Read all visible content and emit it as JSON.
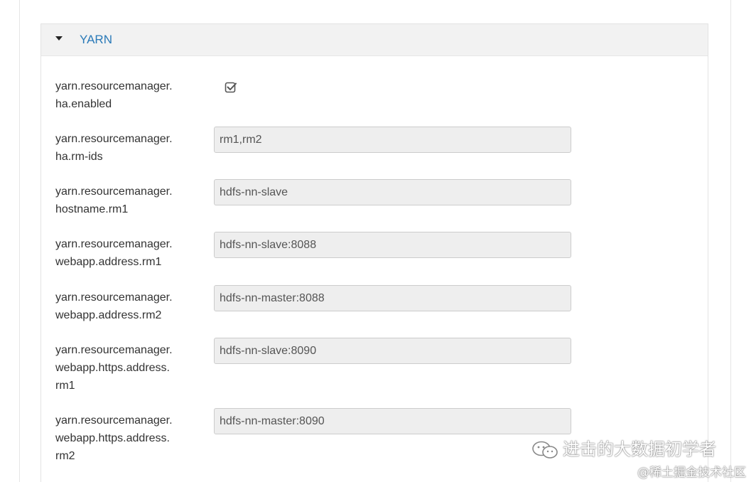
{
  "panel": {
    "title": "YARN"
  },
  "properties": [
    {
      "label_lines": [
        "yarn.resourcemanager.",
        "ha.enabled"
      ],
      "type": "checkbox",
      "checked": true
    },
    {
      "label_lines": [
        "yarn.resourcemanager.",
        "ha.rm-ids"
      ],
      "type": "text",
      "value": "rm1,rm2"
    },
    {
      "label_lines": [
        "yarn.resourcemanager.",
        "hostname.rm1"
      ],
      "type": "text",
      "value": "hdfs-nn-slave"
    },
    {
      "label_lines": [
        "yarn.resourcemanager.",
        "webapp.address.rm1"
      ],
      "type": "text",
      "value": "hdfs-nn-slave:8088"
    },
    {
      "label_lines": [
        "yarn.resourcemanager.",
        "webapp.address.rm2"
      ],
      "type": "text",
      "value": "hdfs-nn-master:8088"
    },
    {
      "label_lines": [
        "yarn.resourcemanager.",
        "webapp.https.address.",
        "rm1"
      ],
      "type": "text",
      "value": "hdfs-nn-slave:8090"
    },
    {
      "label_lines": [
        "yarn.resourcemanager.",
        "webapp.https.address.",
        "rm2"
      ],
      "type": "text",
      "value": "hdfs-nn-master:8090"
    }
  ],
  "watermark": {
    "line1": "进击的大数据初学者",
    "line2": "@稀土掘金技术社区"
  },
  "icons": {
    "caret": "caret-down-icon",
    "checkbox": "checkbox-checked-icon",
    "wechat": "wechat-icon"
  },
  "colors": {
    "title": "#2a7ab8",
    "header_bg": "#f2f2f2",
    "field_bg": "#eeeeee"
  }
}
